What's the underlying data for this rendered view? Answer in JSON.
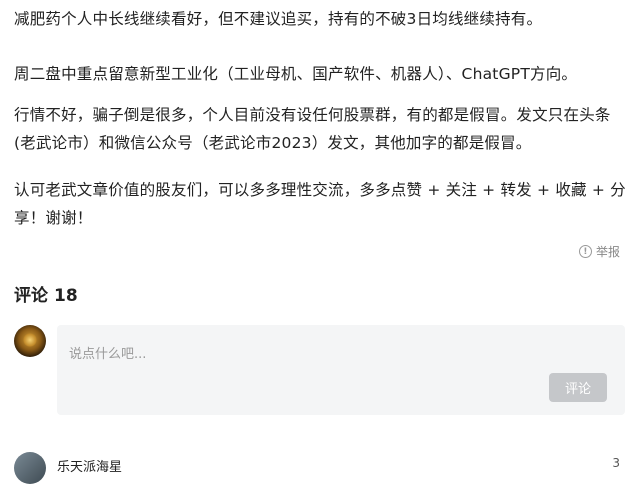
{
  "article": {
    "paragraphs": [
      "减肥药个人中长线继续看好，但不建议追买，持有的不破3日均线继续持有。",
      "周二盘中重点留意新型工业化（工业母机、国产软件、机器人）、ChatGPT方向。",
      "行情不好，骗子倒是很多，个人目前没有设任何股票群，有的都是假冒。发文只在头条(老武论市）和微信公众号（老武论市2023）发文，其他加字的都是假冒。",
      "认可老武文章价值的股友们，可以多多理性交流，多多点赞 + 关注 + 转发 + 收藏 + 分享！谢谢！"
    ],
    "report_label": "举报"
  },
  "comments": {
    "title": "评论",
    "count": "18",
    "input_placeholder": "说点什么吧...",
    "submit_label": "评论",
    "next_comment": {
      "username": "乐天派海星",
      "likes": "3"
    }
  }
}
